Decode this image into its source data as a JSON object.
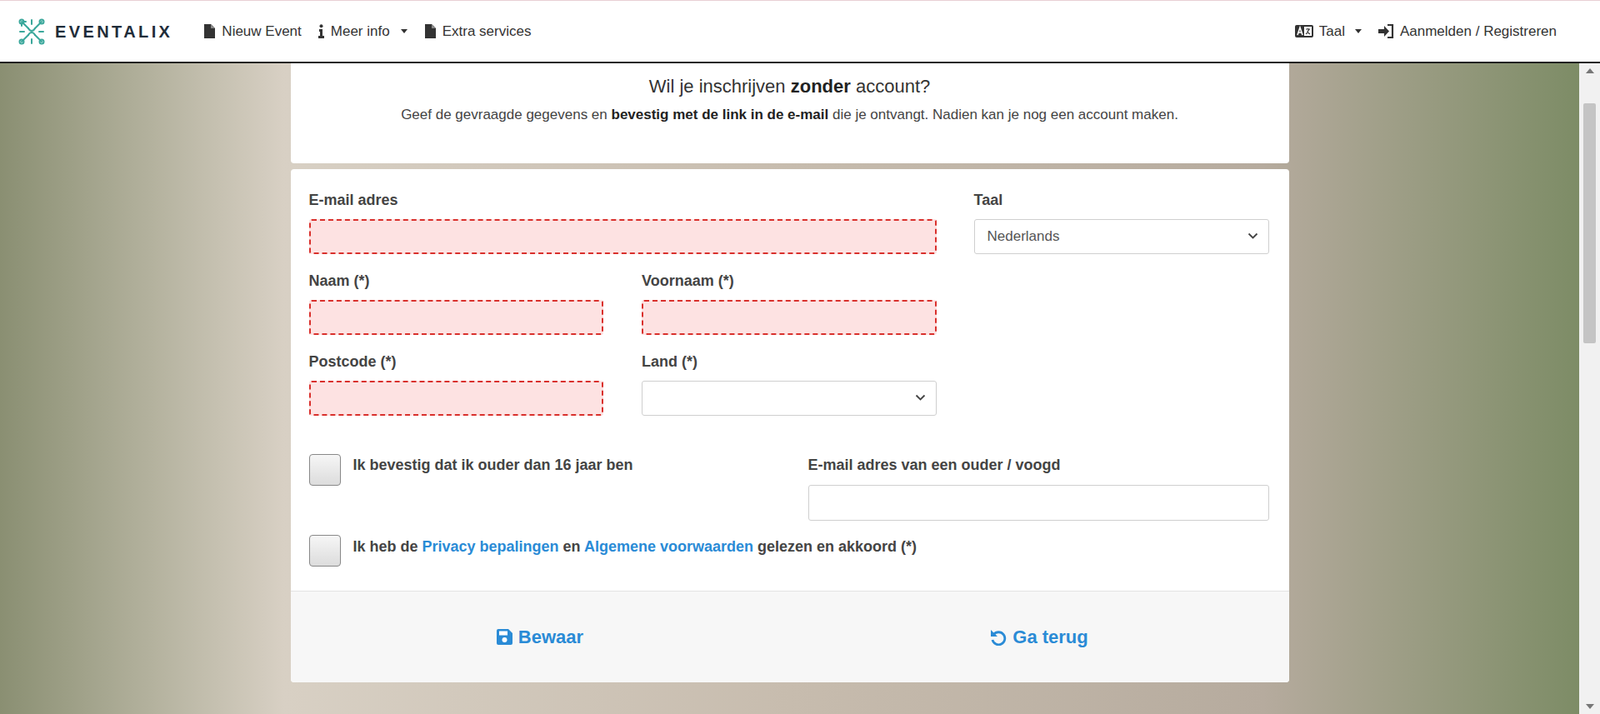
{
  "nav": {
    "logo": "EVENTALIX",
    "items": [
      {
        "label": "Nieuw Event",
        "kind": "link"
      },
      {
        "label": "Meer info",
        "kind": "dropdown"
      },
      {
        "label": "Extra services",
        "kind": "link"
      }
    ],
    "right": [
      {
        "label": "Taal",
        "kind": "dropdown"
      },
      {
        "label": "Aanmelden / Registreren",
        "kind": "link"
      }
    ]
  },
  "intro": {
    "title": [
      {
        "text": "Wil je inschrijven ",
        "bold": false
      },
      {
        "text": "zonder",
        "bold": true
      },
      {
        "text": " account?",
        "bold": false
      }
    ],
    "subtitle": [
      {
        "text": "Geef de gevraagde gegevens en ",
        "bold": false
      },
      {
        "text": "bevestig met de link in de e-mail",
        "bold": true
      },
      {
        "text": " die je ontvangt. Nadien kan je nog een account maken.",
        "bold": false
      }
    ]
  },
  "form": {
    "email": {
      "label": "E-mail adres",
      "value": "",
      "invalid": true
    },
    "language": {
      "label": "Taal",
      "value": "Nederlands",
      "invalid": false
    },
    "name": {
      "label": "Naam (*)",
      "value": "",
      "invalid": true
    },
    "firstname": {
      "label": "Voornaam (*)",
      "value": "",
      "invalid": true
    },
    "postcode": {
      "label": "Postcode (*)",
      "value": "",
      "invalid": true
    },
    "country": {
      "label": "Land (*)",
      "value": "",
      "invalid": false
    },
    "age_check": {
      "label": "Ik bevestig dat ik ouder dan 16 jaar ben",
      "checked": false
    },
    "parent_email": {
      "label": "E-mail adres van een ouder / voogd",
      "value": "",
      "invalid": false
    },
    "terms": {
      "checked": false,
      "segments": [
        {
          "text": "Ik heb de ",
          "link": false
        },
        {
          "text": "Privacy bepalingen",
          "link": true
        },
        {
          "text": " en ",
          "link": false
        },
        {
          "text": "Algemene voorwaarden",
          "link": true
        },
        {
          "text": " gelezen en akkoord (*)",
          "link": false
        }
      ]
    }
  },
  "footer": {
    "buttons": [
      {
        "label": "Bewaar"
      },
      {
        "label": "Ga terug"
      }
    ]
  }
}
